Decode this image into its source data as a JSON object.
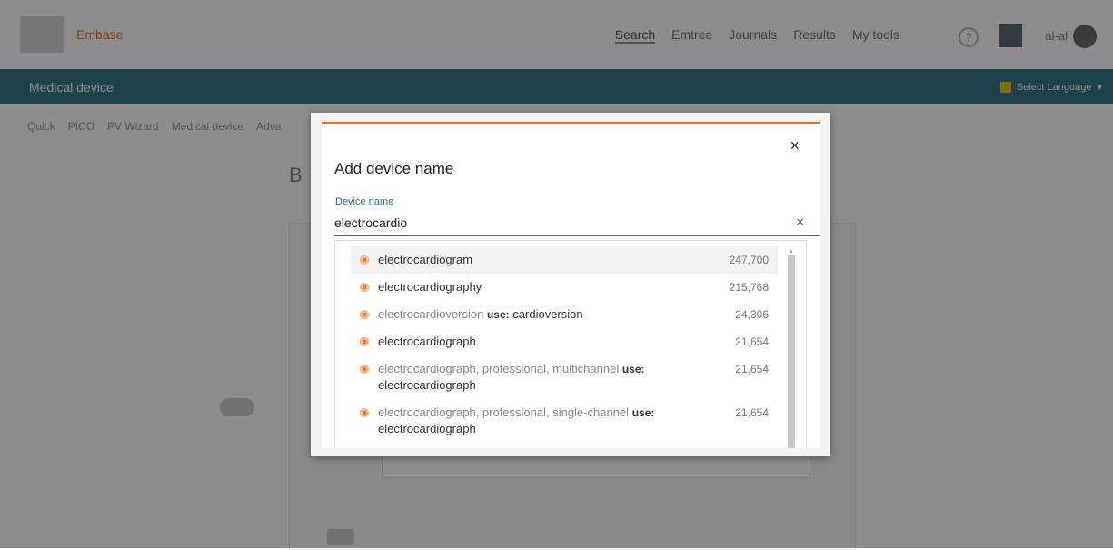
{
  "app": {
    "logo_text": "Embase",
    "section_title": "Medical device"
  },
  "topnav": [
    "Search",
    "Emtree",
    "Journals",
    "Results",
    "My tools"
  ],
  "subnav": [
    "Quick",
    "PICO",
    "PV Wizard",
    "Medical device",
    "Adva"
  ],
  "user": {
    "initials": "al-al"
  },
  "language": "Select Language",
  "page_heading": "B",
  "modal": {
    "title": "Add device name",
    "field_label": "Device name",
    "input_value": "electrocardio",
    "close_icon": "×",
    "clear_icon": "×"
  },
  "suggestions": [
    {
      "term": "electrocardiogram",
      "use": "",
      "target": "",
      "count": "247,700",
      "dim": false
    },
    {
      "term": "electrocardiography",
      "use": "",
      "target": "",
      "count": "215,768",
      "dim": false
    },
    {
      "term": "electrocardioversion",
      "use": "use:",
      "target": "cardioversion",
      "count": "24,306",
      "dim": true
    },
    {
      "term": "electrocardiograph",
      "use": "",
      "target": "",
      "count": "21,654",
      "dim": false
    },
    {
      "term": "electrocardiograph, professional, multichannel",
      "use": "use:",
      "target": "electrocardiograph",
      "count": "21,654",
      "dim": true
    },
    {
      "term": "electrocardiograph, professional, single-channel",
      "use": "use:",
      "target": "electrocardiograph",
      "count": "21,654",
      "dim": true
    }
  ],
  "colors": {
    "accent": "#e9711c",
    "banner": "#357a8d",
    "link": "#2e6c8a"
  }
}
